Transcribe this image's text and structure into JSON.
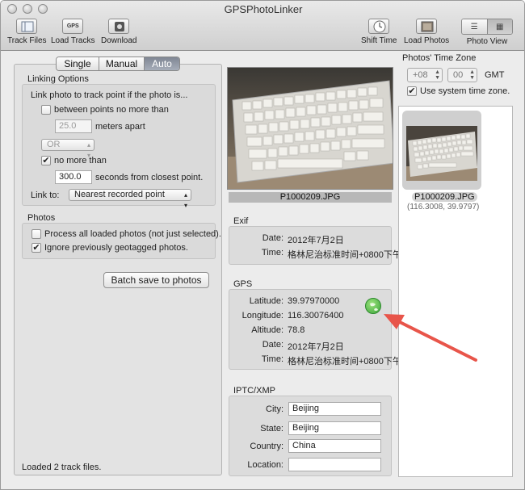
{
  "window": {
    "title": "GPSPhotoLinker"
  },
  "toolbar": {
    "track_files": "Track Files",
    "load_tracks": "Load Tracks",
    "download": "Download",
    "shift_time": "Shift Time",
    "load_photos": "Load Photos",
    "photo_view": "Photo View",
    "gps_icon_text": "GPS"
  },
  "mode_tabs": {
    "single": "Single",
    "manual": "Manual",
    "auto": "Auto",
    "selected": "Auto"
  },
  "linking": {
    "group_title": "Linking Options",
    "intro": "Link photo to track point if the photo is...",
    "between_points_label": "between points no more than",
    "between_points_checked": false,
    "meters_value": "25.0",
    "meters_label": "meters apart",
    "operator_value": "OR",
    "no_more_than_label": "no more than",
    "no_more_than_checked": true,
    "seconds_value": "300.0",
    "seconds_label": "seconds from closest point.",
    "link_to_label": "Link to:",
    "link_to_value": "Nearest recorded point"
  },
  "photos_options": {
    "group_title": "Photos",
    "process_all_label": "Process all loaded photos (not just selected).",
    "process_all_checked": false,
    "ignore_label": "Ignore previously geotagged photos.",
    "ignore_checked": true
  },
  "batch_button": "Batch save to photos",
  "status": "Loaded 2 track files.",
  "preview": {
    "filename": "P1000209.JPG"
  },
  "exif": {
    "title": "Exif",
    "date_label": "Date:",
    "date_value": "2012年7月2日",
    "time_label": "Time:",
    "time_value": "格林尼治标准时间+0800下午"
  },
  "gps": {
    "title": "GPS",
    "latitude_label": "Latitude:",
    "latitude_value": "39.97970000",
    "longitude_label": "Longitude:",
    "longitude_value": "116.30076400",
    "altitude_label": "Altitude:",
    "altitude_value": "78.8",
    "date_label": "Date:",
    "date_value": "2012年7月2日",
    "time_label": "Time:",
    "time_value": "格林尼治标准时间+0800下午"
  },
  "iptc": {
    "title": "IPTC/XMP",
    "city_label": "City:",
    "city_value": "Beijing",
    "state_label": "State:",
    "state_value": "Beijing",
    "country_label": "Country:",
    "country_value": "China",
    "location_label": "Location:",
    "location_value": ""
  },
  "timezone": {
    "title": "Photos' Time Zone",
    "hours_value": "+08",
    "minutes_value": "00",
    "gmt_label": "GMT",
    "use_system_label": "Use system time zone.",
    "use_system_checked": true
  },
  "browser": {
    "items": [
      {
        "filename": "P1000209.JPG",
        "coords": "(116.3008, 39.9797)"
      }
    ]
  },
  "colors": {
    "arrow": "#e8554a",
    "selected_tab": "#8d94a0",
    "globe": "#3ba43a"
  },
  "icons": [
    "track-files-icon",
    "gps-icon",
    "download-icon",
    "clock-icon",
    "load-photos-icon",
    "list-view-icon",
    "grid-view-icon",
    "globe-icon",
    "checkmark-icon",
    "chevron-down-icon"
  ]
}
